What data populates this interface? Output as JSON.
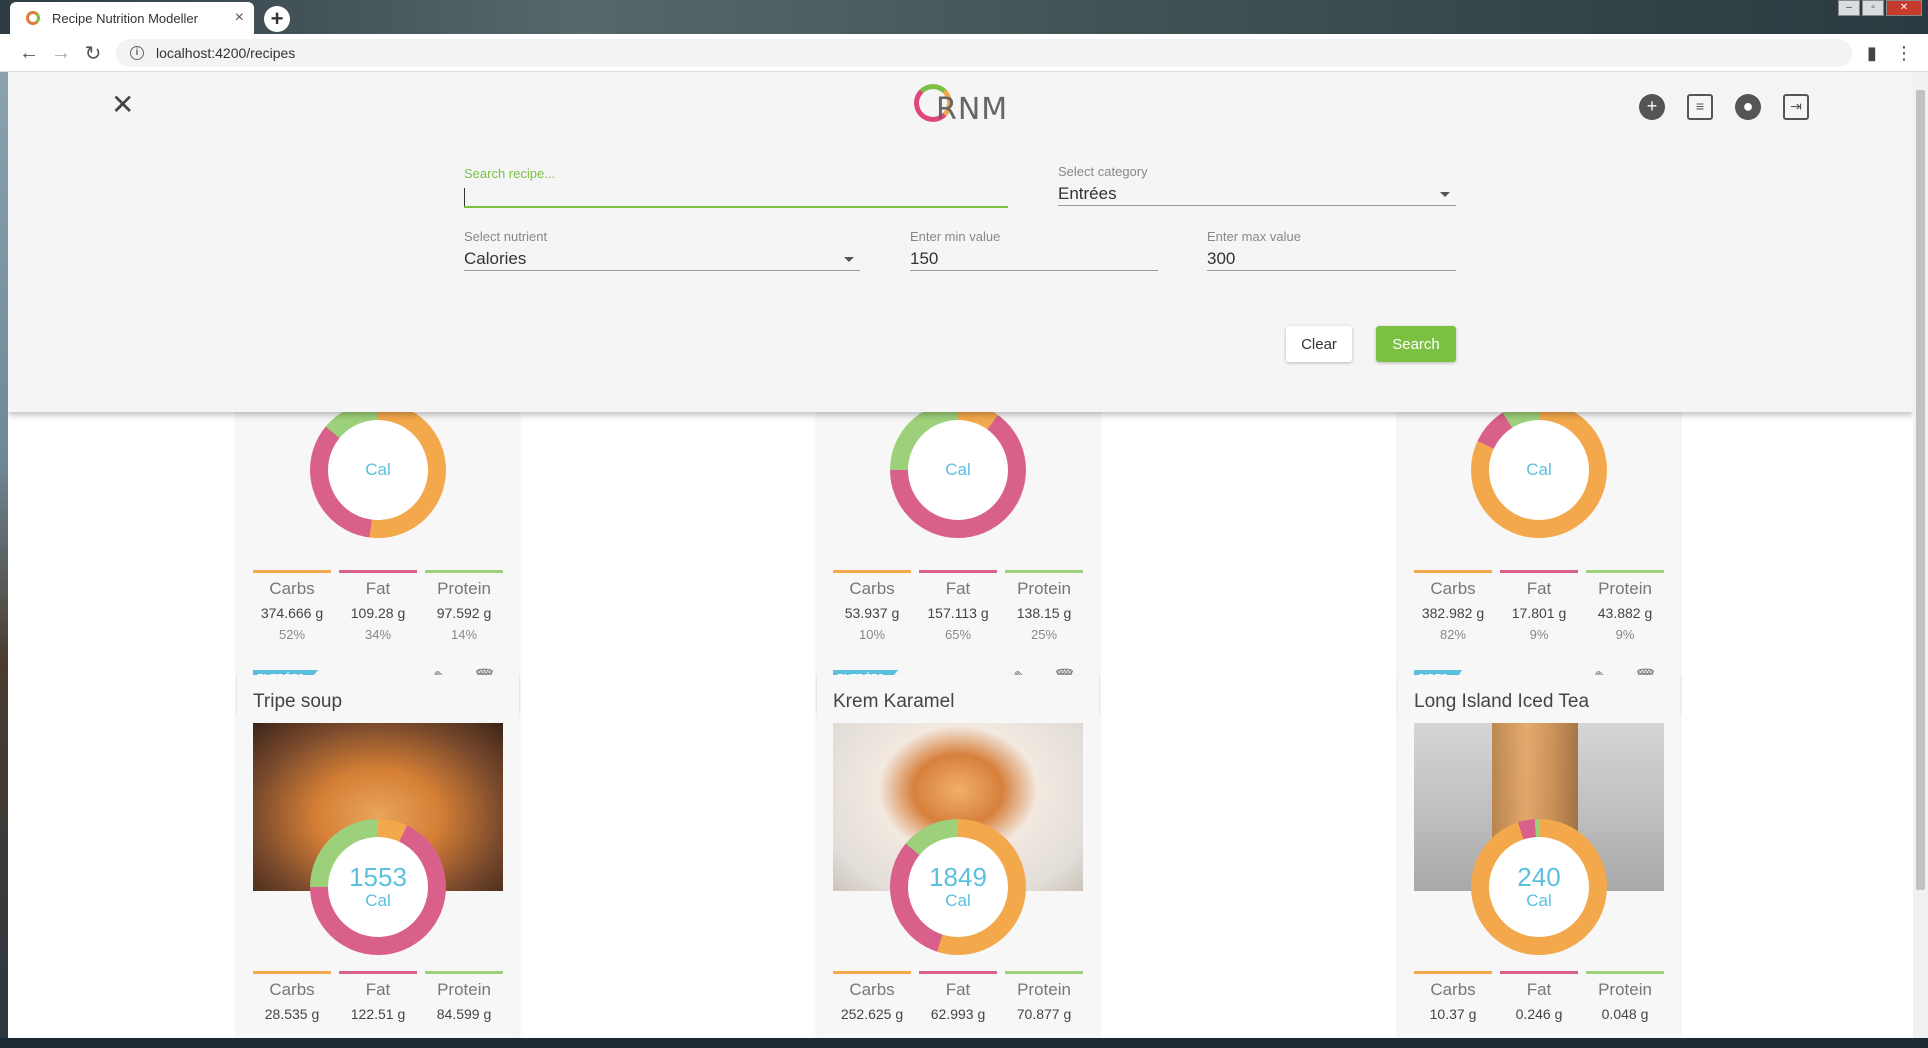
{
  "browser": {
    "tab_title": "Recipe Nutrition Modeller",
    "tab_close": "×",
    "new_tab": "+",
    "url": "localhost:4200/recipes",
    "nav_back": "←",
    "nav_forward": "→",
    "reload": "↻",
    "info": "i",
    "win_min": "–",
    "win_max": "▫",
    "win_close": "✕"
  },
  "header": {
    "close": "✕",
    "logo_text": "RNM"
  },
  "search": {
    "recipe_label": "Search recipe...",
    "recipe_value": "",
    "category_label": "Select category",
    "category_value": "Entrées",
    "nutrient_label": "Select nutrient",
    "nutrient_value": "Calories",
    "min_label": "Enter min value",
    "min_value": "150",
    "max_label": "Enter max value",
    "max_value": "300",
    "clear_label": "Clear",
    "search_label": "Search"
  },
  "colors": {
    "accent_green": "#7bc043",
    "carbs": "#f3a84b",
    "fat": "#d9608a",
    "protein": "#9dd07a",
    "calories_text": "#5bc0de"
  },
  "macro_labels": {
    "carbs": "Carbs",
    "fat": "Fat",
    "protein": "Protein"
  },
  "cards_top": [
    {
      "calories_unit": "Cal",
      "carbs_g": "374.666 g",
      "fat_g": "109.28 g",
      "protein_g": "97.592 g",
      "carbs_pct": "52%",
      "fat_pct": "34%",
      "protein_pct": "14%",
      "category": "ENTRÉES"
    },
    {
      "calories_unit": "Cal",
      "carbs_g": "53.937 g",
      "fat_g": "157.113 g",
      "protein_g": "138.15 g",
      "carbs_pct": "10%",
      "fat_pct": "65%",
      "protein_pct": "25%",
      "category": "ENTRÉES"
    },
    {
      "calories_unit": "Cal",
      "carbs_g": "382.982 g",
      "fat_g": "17.801 g",
      "protein_g": "43.882 g",
      "carbs_pct": "82%",
      "fat_pct": "9%",
      "protein_pct": "9%",
      "category": "SIDES"
    }
  ],
  "cards_bottom": [
    {
      "title": "Tripe soup",
      "calories": "1553",
      "calories_unit": "Cal",
      "carbs_g": "28.535 g",
      "fat_g": "122.51 g",
      "protein_g": "84.599 g"
    },
    {
      "title": "Krem Karamel",
      "calories": "1849",
      "calories_unit": "Cal",
      "carbs_g": "252.625 g",
      "fat_g": "62.993 g",
      "protein_g": "70.877 g"
    },
    {
      "title": "Long Island Iced Tea",
      "calories": "240",
      "calories_unit": "Cal",
      "carbs_g": "10.37 g",
      "fat_g": "0.246 g",
      "protein_g": "0.048 g"
    }
  ],
  "icons": {
    "add": "+",
    "recipes": "≡",
    "account": "●",
    "logout": "⇥",
    "edit": "✎",
    "delete": "🗑"
  }
}
